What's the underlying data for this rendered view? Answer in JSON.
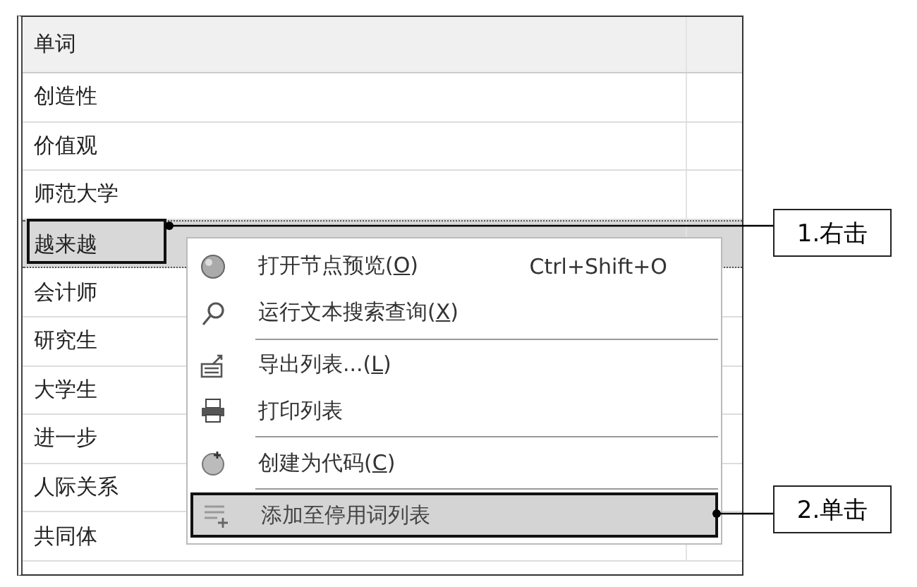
{
  "table": {
    "header": "单词",
    "rows": [
      {
        "word": "创造性",
        "selected": false
      },
      {
        "word": "价值观",
        "selected": false
      },
      {
        "word": "师范大学",
        "selected": false
      },
      {
        "word": "越来越",
        "selected": true
      },
      {
        "word": "会计师",
        "selected": false
      },
      {
        "word": "研究生",
        "selected": false
      },
      {
        "word": "大学生",
        "selected": false
      },
      {
        "word": "进一步",
        "selected": false
      },
      {
        "word": "人际关系",
        "selected": false
      },
      {
        "word": "共同体",
        "selected": false
      }
    ]
  },
  "context_menu": {
    "items": [
      {
        "kind": "item",
        "label_parts": [
          "打开节点预览(",
          "O",
          ")"
        ],
        "shortcut": "Ctrl+Shift+O",
        "selected": false
      },
      {
        "kind": "item",
        "label_parts": [
          "运行文本搜索查询(",
          "X",
          ")"
        ],
        "selected": false
      },
      {
        "kind": "separator"
      },
      {
        "kind": "item",
        "label_parts": [
          "导出列表...(",
          "L",
          ")"
        ],
        "selected": false
      },
      {
        "kind": "item",
        "label_parts": [
          "打印列表"
        ],
        "selected": false
      },
      {
        "kind": "separator"
      },
      {
        "kind": "item",
        "label_parts": [
          "创建为代码(",
          "C",
          ")"
        ],
        "selected": false
      },
      {
        "kind": "separator"
      },
      {
        "kind": "item",
        "label_parts": [
          "添加至停用词列表"
        ],
        "selected": true
      }
    ]
  },
  "callouts": [
    {
      "text": "1.右击"
    },
    {
      "text": "2.单击"
    }
  ]
}
